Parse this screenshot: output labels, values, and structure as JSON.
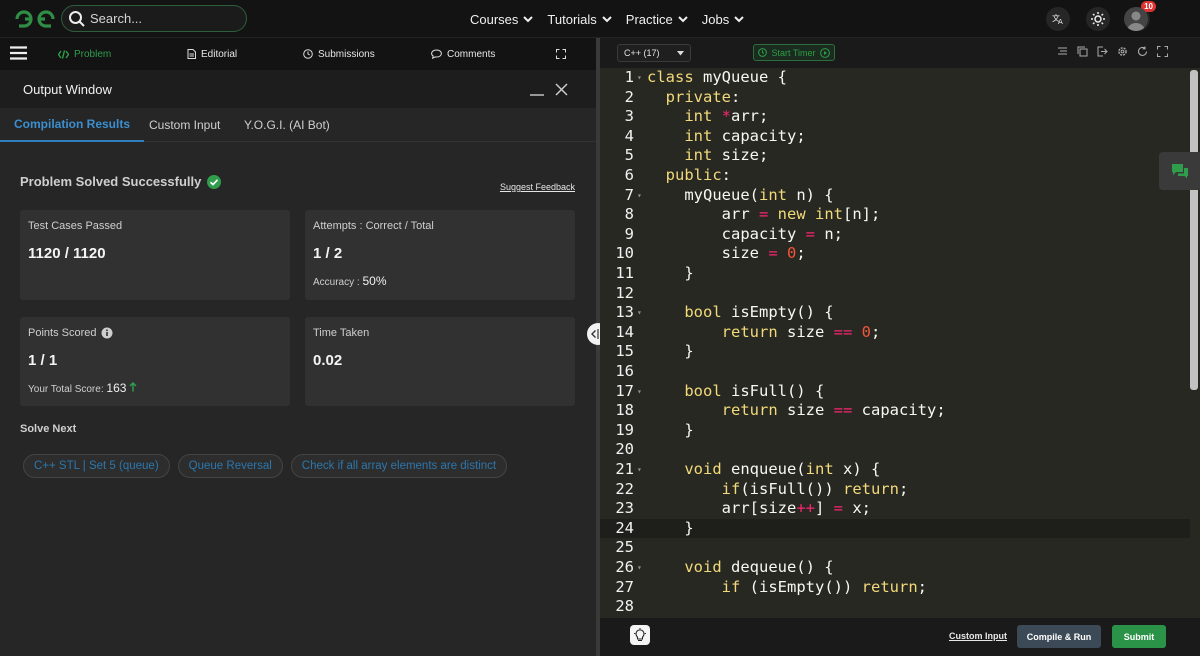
{
  "topnav": {
    "search_placeholder": "Search...",
    "links": [
      "Courses",
      "Tutorials",
      "Practice",
      "Jobs"
    ],
    "notification_count": "10"
  },
  "problem_tabs": {
    "problem": "Problem",
    "editorial": "Editorial",
    "submissions": "Submissions",
    "comments": "Comments"
  },
  "output": {
    "title": "Output Window",
    "tabs": [
      "Compilation Results",
      "Custom Input",
      "Y.O.G.I. (AI Bot)"
    ],
    "status": "Problem Solved Successfully",
    "feedback": "Suggest Feedback",
    "tests_label": "Test Cases Passed",
    "tests_value": "1120 / 1120",
    "attempts_label": "Attempts : Correct / Total",
    "attempts_value": "1 / 2",
    "accuracy_label": "Accuracy :",
    "accuracy_value": "50%",
    "points_label": "Points Scored",
    "points_value": "1 / 1",
    "total_label": "Your Total Score:",
    "total_value": "163",
    "time_label": "Time Taken",
    "time_value": "0.02",
    "solve_next": "Solve Next",
    "next": [
      "C++ STL | Set 5 (queue)",
      "Queue Reversal",
      "Check if all array elements are distinct"
    ]
  },
  "editor": {
    "language": "C++ (17)",
    "timer": "Start Timer",
    "custom_input": "Custom Input",
    "compile": "Compile & Run",
    "submit": "Submit"
  },
  "code_lines": [
    "class myQueue {",
    "  private:",
    "    int *arr;",
    "    int capacity;",
    "    int size;",
    "  public:",
    "    myQueue(int n) {",
    "        arr = new int[n];",
    "        capacity = n;",
    "        size = 0;",
    "    }",
    "",
    "    bool isEmpty() {",
    "        return size == 0;",
    "    }",
    "",
    "    bool isFull() {",
    "        return size == capacity;",
    "    }",
    "",
    "    void enqueue(int x) {",
    "        if(isFull()) return;",
    "        arr[size++] = x;",
    "    }",
    "",
    "    void dequeue() {",
    "        if (isEmpty()) return;",
    ""
  ],
  "colors": {
    "accent_green": "#2b9348",
    "link_blue": "#2d77ad",
    "editor_bg": "#272822"
  }
}
